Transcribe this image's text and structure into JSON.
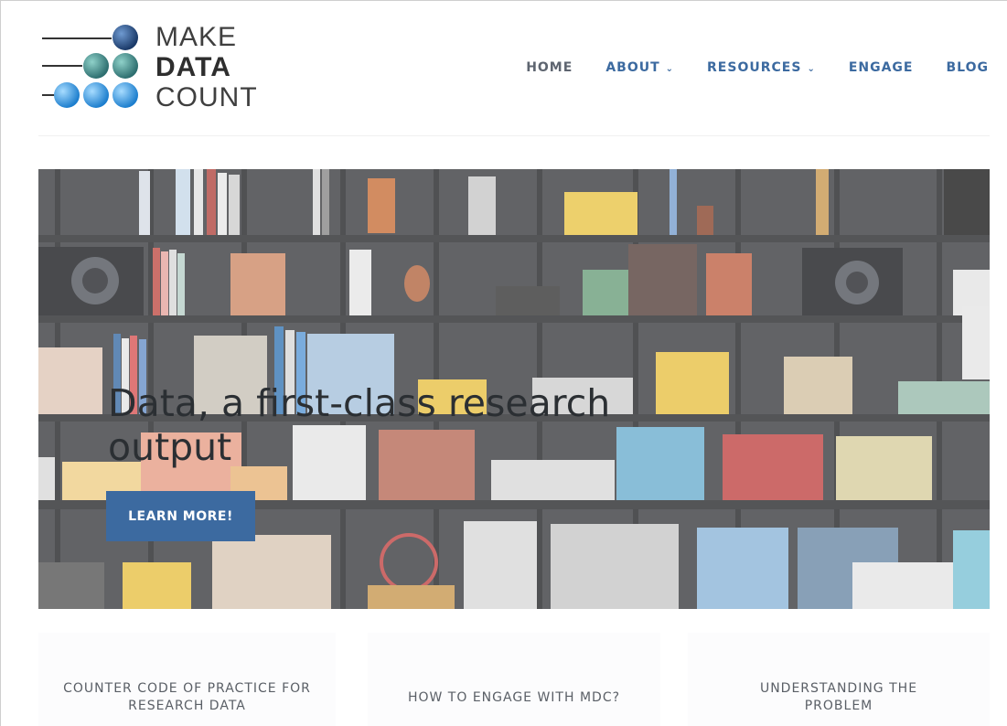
{
  "brand": {
    "logo_lines": [
      "MAKE",
      "DATA",
      "COUNT"
    ],
    "colors": {
      "dark_blue": "#1f3f6e",
      "teal": "#3a8a84",
      "light_blue": "#2e8fd8"
    }
  },
  "nav": {
    "items": [
      {
        "label": "HOME",
        "has_dropdown": false
      },
      {
        "label": "ABOUT",
        "has_dropdown": true
      },
      {
        "label": "RESOURCES",
        "has_dropdown": true
      },
      {
        "label": "ENGAGE",
        "has_dropdown": false
      },
      {
        "label": "BLOG",
        "has_dropdown": false
      }
    ],
    "chevron": "⌄"
  },
  "hero": {
    "title": "Data, a first-class research output",
    "button_label": "LEARN MORE!",
    "accent_color": "#3c6aa0"
  },
  "cards": [
    {
      "title": "COUNTER CODE OF PRACTICE FOR RESEARCH DATA"
    },
    {
      "title": "HOW TO ENGAGE WITH MDC?"
    },
    {
      "title": "UNDERSTANDING THE PROBLEM"
    }
  ]
}
